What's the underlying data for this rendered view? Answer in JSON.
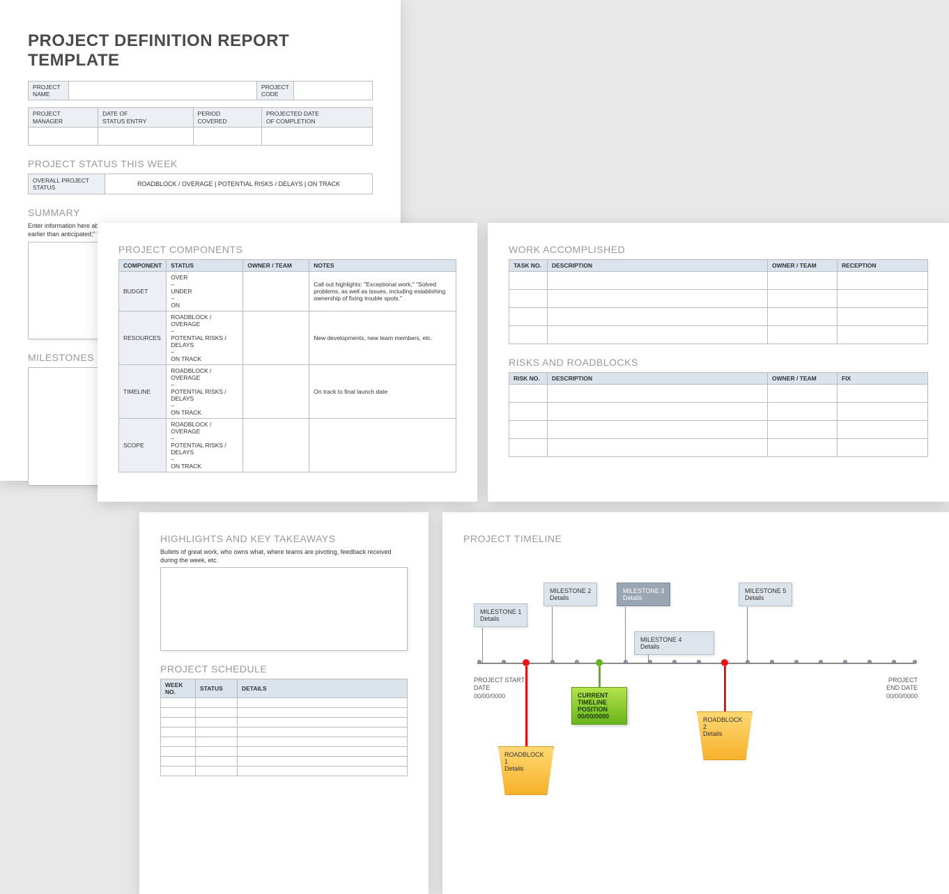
{
  "title": "PROJECT DEFINITION REPORT TEMPLATE",
  "header_row1": {
    "name_label": "PROJECT\nNAME",
    "code_label": "PROJECT\nCODE"
  },
  "header_row2": {
    "manager": "PROJECT\nMANAGER",
    "date_entry": "DATE OF\nSTATUS ENTRY",
    "period": "PERIOD\nCOVERED",
    "proj_date": "PROJECTED DATE\nOF COMPLETION"
  },
  "status_week": {
    "heading": "PROJECT STATUS THIS WEEK",
    "label": "OVERALL PROJECT STATUS",
    "options": "ROADBLOCK / OVERAGE    |    POTENTIAL RISKS / DELAYS    |    ON TRACK"
  },
  "summary": {
    "heading": "SUMMARY",
    "note": "Enter information here about the overall status and highlights: \"Regained lost time from last period;\" \"QA began two days earlier than anticipated;\" \"Delay in some client feedback, but minimal.\""
  },
  "milestones_heading": "MILESTONES",
  "components": {
    "heading": "PROJECT COMPONENTS",
    "cols": [
      "COMPONENT",
      "STATUS",
      "OWNER / TEAM",
      "NOTES"
    ],
    "rows": [
      {
        "name": "BUDGET",
        "status": "OVER\n–\nUNDER\n–\nON",
        "notes": "Call out highlights: \"Exceptional work,\" \"Solved problems, as well as issues, including establishing ownership of fixing trouble spots.\""
      },
      {
        "name": "RESOURCES",
        "status": "ROADBLOCK / OVERAGE\n–\nPOTENTIAL RISKS / DELAYS\n–\nON TRACK",
        "notes": "New developments, new team members, etc."
      },
      {
        "name": "TIMELINE",
        "status": "ROADBLOCK / OVERAGE\n–\nPOTENTIAL RISKS / DELAYS\n–\nON TRACK",
        "notes": "On track to final launch date"
      },
      {
        "name": "SCOPE",
        "status": "ROADBLOCK / OVERAGE\n–\nPOTENTIAL RISKS / DELAYS\n–\nON TRACK",
        "notes": ""
      }
    ]
  },
  "work": {
    "heading": "WORK ACCOMPLISHED",
    "cols": [
      "TASK NO.",
      "DESCRIPTION",
      "OWNER / TEAM",
      "RECEPTION"
    ]
  },
  "risks": {
    "heading": "RISKS AND ROADBLOCKS",
    "cols": [
      "RISK NO.",
      "DESCRIPTION",
      "OWNER / TEAM",
      "FIX"
    ]
  },
  "highlights": {
    "heading": "HIGHLIGHTS AND KEY TAKEAWAYS",
    "note": "Bullets of great work, who owns what, where teams are pivoting, feedback received during the week, etc."
  },
  "schedule": {
    "heading": "PROJECT SCHEDULE",
    "cols": [
      "WEEK NO.",
      "STATUS",
      "DETAILS"
    ]
  },
  "timeline": {
    "heading": "PROJECT TIMELINE",
    "start_label": "PROJECT START\nDATE\n00/00/0000",
    "end_label": "PROJECT\nEND DATE\n00/00/0000",
    "milestones": [
      {
        "label": "MILESTONE 1",
        "detail": "Details"
      },
      {
        "label": "MILESTONE 2",
        "detail": "Details"
      },
      {
        "label": "MILESTONE 3",
        "detail": "Details"
      },
      {
        "label": "MILESTONE 4",
        "detail": "Details"
      },
      {
        "label": "MILESTONE 5",
        "detail": "Details"
      }
    ],
    "roadblocks": [
      {
        "label": "ROADBLOCK 1",
        "detail": "Details"
      },
      {
        "label": "ROADBLOCK 2",
        "detail": "Details"
      }
    ],
    "current": {
      "label": "CURRENT\nTIMELINE\nPOSITION\n00/00/0000"
    }
  }
}
